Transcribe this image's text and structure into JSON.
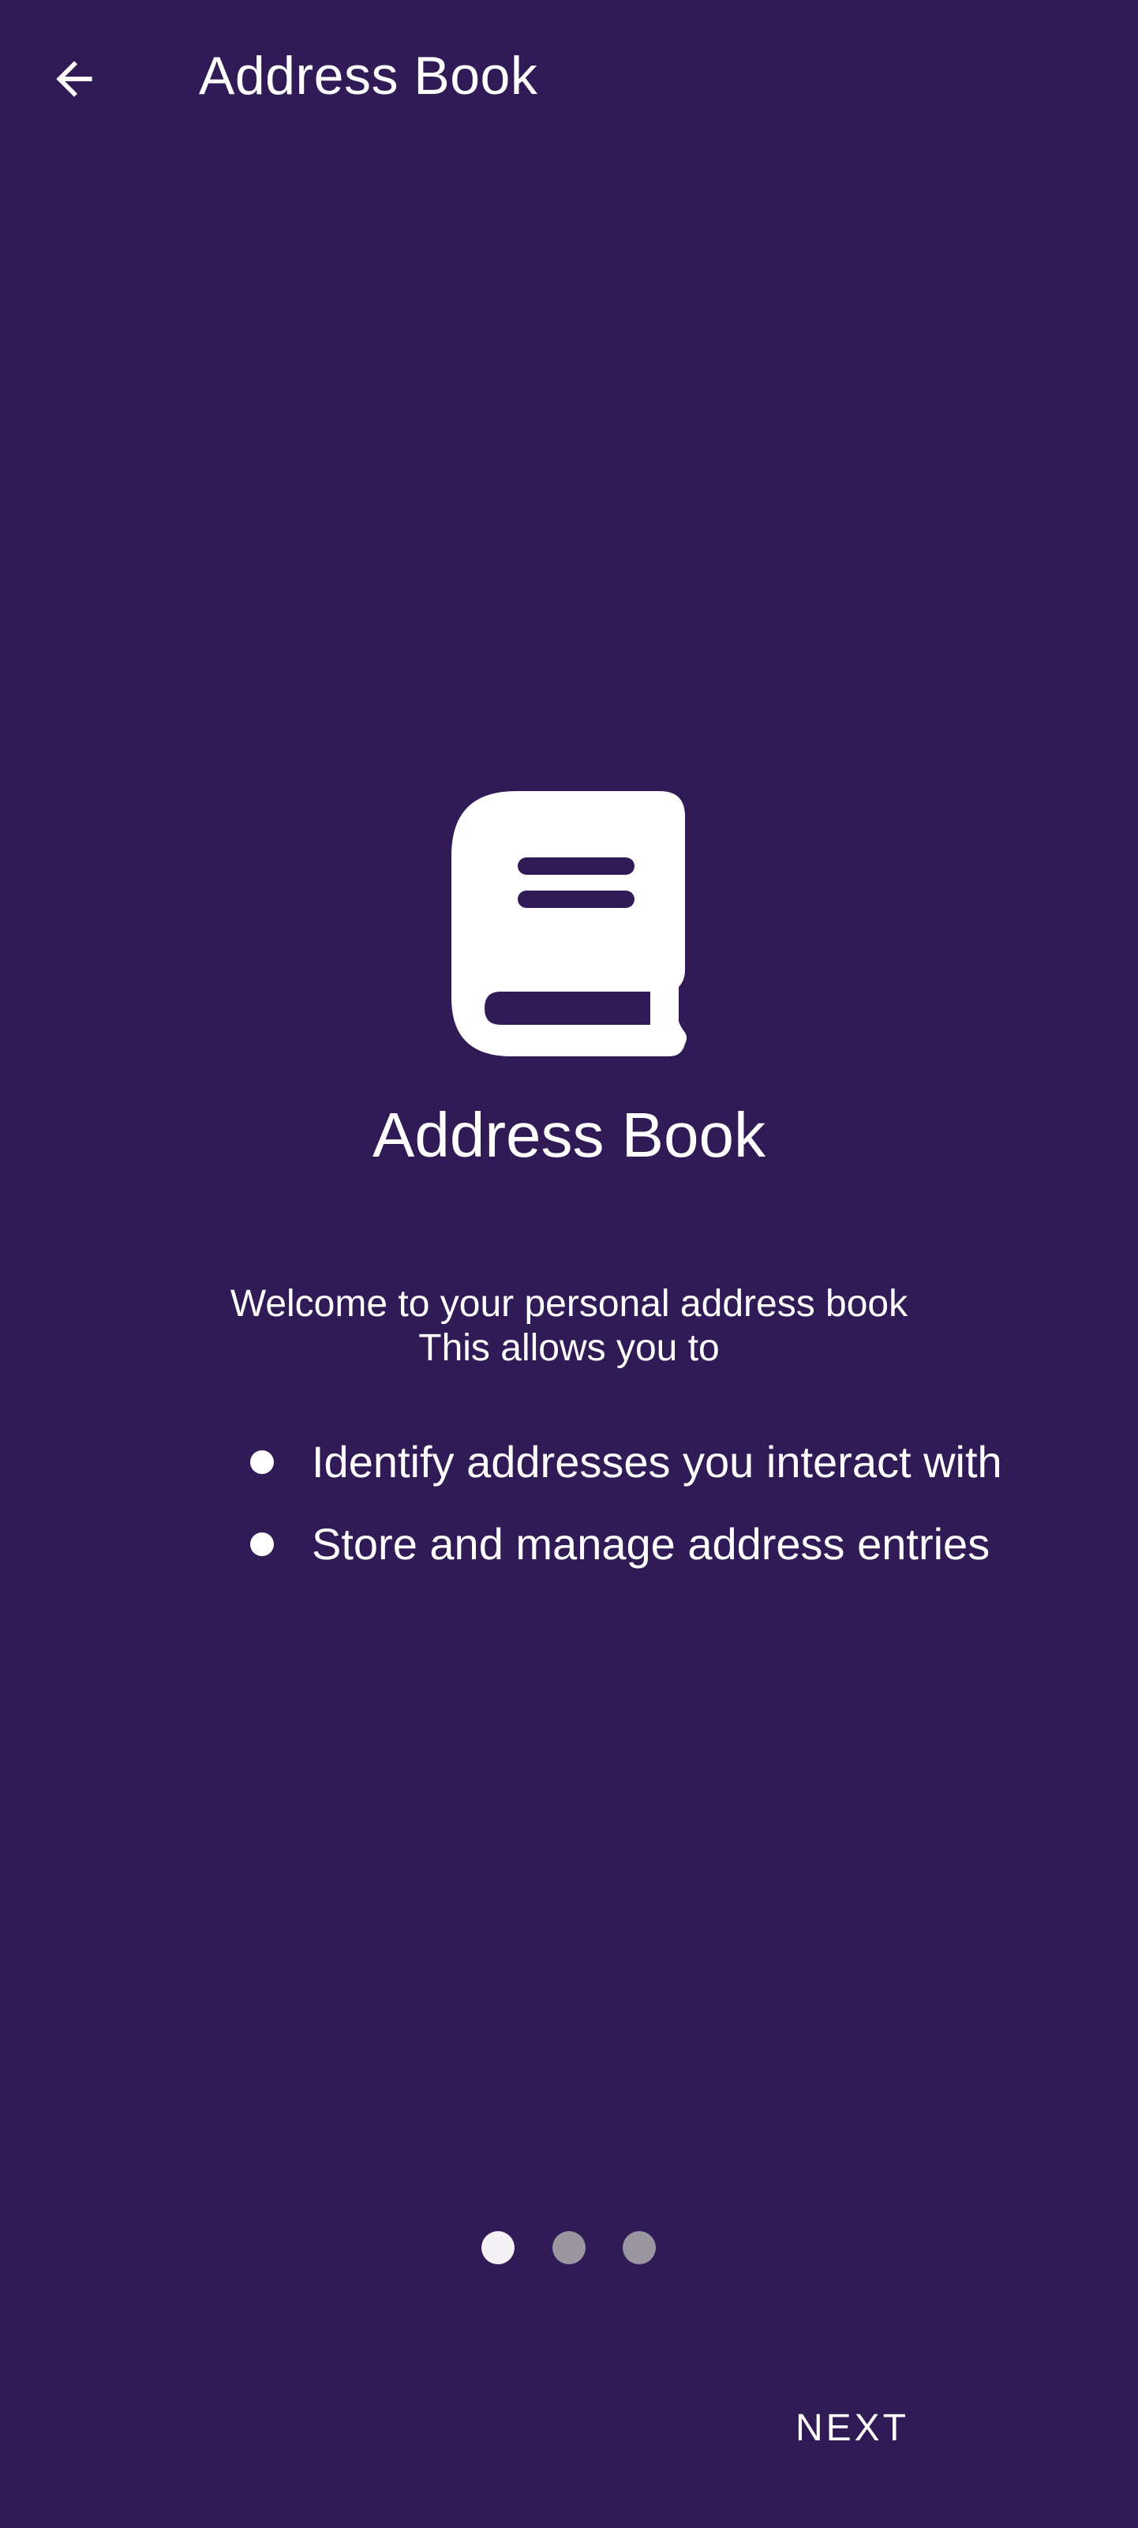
{
  "app_bar": {
    "back_icon": "arrow-back-icon",
    "title": "Address Book"
  },
  "hero": {
    "icon": "book-icon",
    "title": "Address Book",
    "welcome_line1": "Welcome to your personal address book",
    "welcome_line2": "This allows you to"
  },
  "features": [
    {
      "text": "Identify addresses you interact with"
    },
    {
      "text": "Store and manage address entries"
    }
  ],
  "pager": {
    "pages": 3,
    "current": 1
  },
  "actions": {
    "next_label": "NEXT"
  },
  "colors": {
    "background": "#311b57",
    "foreground": "#ffffff",
    "dot_inactive": "#9a96a0",
    "dot_active": "#f4f2f6"
  }
}
